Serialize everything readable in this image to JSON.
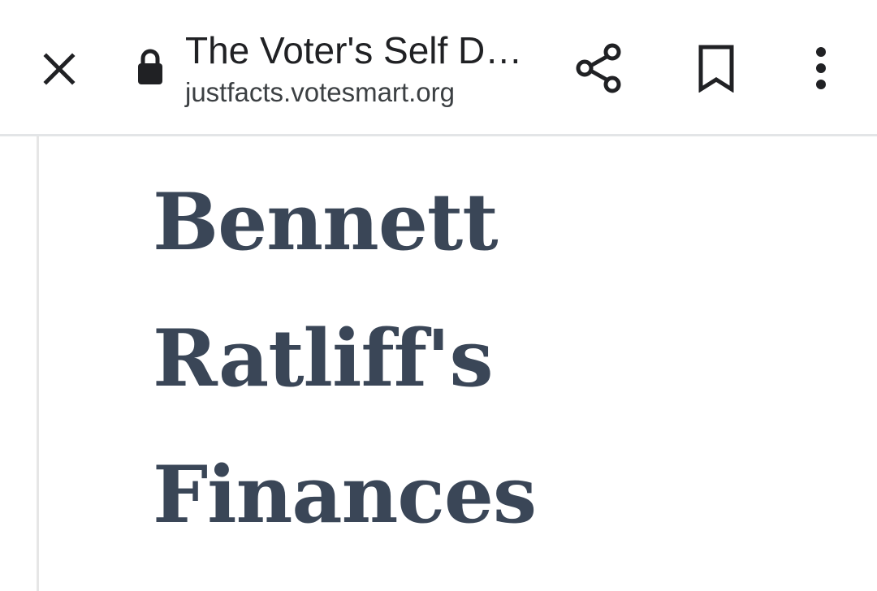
{
  "browser_bar": {
    "page_title": "The Voter's Self D…",
    "url": "justfacts.votesmart.org"
  },
  "icons": {
    "close": "close-icon",
    "lock": "lock-icon",
    "share": "share-icon",
    "bookmark": "bookmark-icon",
    "menu": "more-vert-icon"
  },
  "article": {
    "headline_lines": [
      "Bennett",
      "Ratliff's",
      "Finances"
    ]
  },
  "colors": {
    "headline": "#3a4657",
    "toolbar_icons": "#202124",
    "divider": "#e3e5e7"
  }
}
